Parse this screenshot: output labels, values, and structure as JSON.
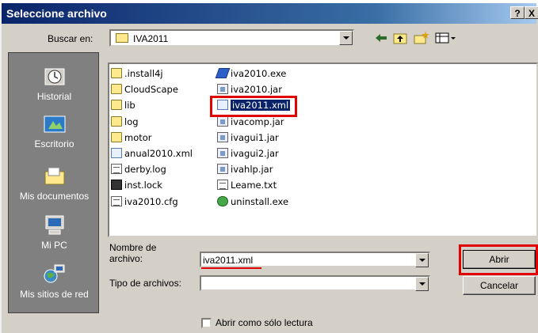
{
  "window": {
    "title": "Seleccione archivo",
    "help_glyph": "?",
    "close_glyph": "X"
  },
  "lookin": {
    "label": "Buscar en:",
    "value": "IVA2011"
  },
  "places": [
    {
      "label": "Historial",
      "icon": "history-icon"
    },
    {
      "label": "Escritorio",
      "icon": "desktop-icon"
    },
    {
      "label": "Mis documentos",
      "icon": "my-documents-icon"
    },
    {
      "label": "Mi PC",
      "icon": "my-computer-icon"
    },
    {
      "label": "Mis sitios de red",
      "icon": "network-places-icon"
    }
  ],
  "files": [
    {
      "name": ".install4j",
      "type": "folder"
    },
    {
      "name": "CloudScape",
      "type": "folder"
    },
    {
      "name": "lib",
      "type": "folder"
    },
    {
      "name": "log",
      "type": "folder"
    },
    {
      "name": "motor",
      "type": "folder"
    },
    {
      "name": "anual2010.xml",
      "type": "xml"
    },
    {
      "name": "derby.log",
      "type": "doc"
    },
    {
      "name": "inst.lock",
      "type": "lock"
    },
    {
      "name": "iva2010.cfg",
      "type": "doc"
    },
    {
      "name": "iva2010.exe",
      "type": "exe"
    },
    {
      "name": "iva2010.jar",
      "type": "jar"
    },
    {
      "name": "iva2011.xml",
      "type": "xml",
      "selected": true
    },
    {
      "name": "ivacomp.jar",
      "type": "jar"
    },
    {
      "name": "ivagui1.jar",
      "type": "jar"
    },
    {
      "name": "ivagui2.jar",
      "type": "jar"
    },
    {
      "name": "ivahlp.jar",
      "type": "jar"
    },
    {
      "name": "Leame.txt",
      "type": "doc"
    },
    {
      "name": "uninstall.exe",
      "type": "uninst"
    }
  ],
  "filename": {
    "label_line1": "Nombre de",
    "label_line2": "archivo:",
    "value": "iva2011.xml"
  },
  "filetype": {
    "label": "Tipo de archivos:",
    "value": ""
  },
  "buttons": {
    "open": "Abrir",
    "cancel": "Cancelar"
  },
  "readonly": {
    "label": "Abrir como sólo lectura",
    "checked": false
  },
  "colors": {
    "highlight": "#e00000",
    "titlebar": "#0a246a",
    "selection": "#0a246a"
  }
}
